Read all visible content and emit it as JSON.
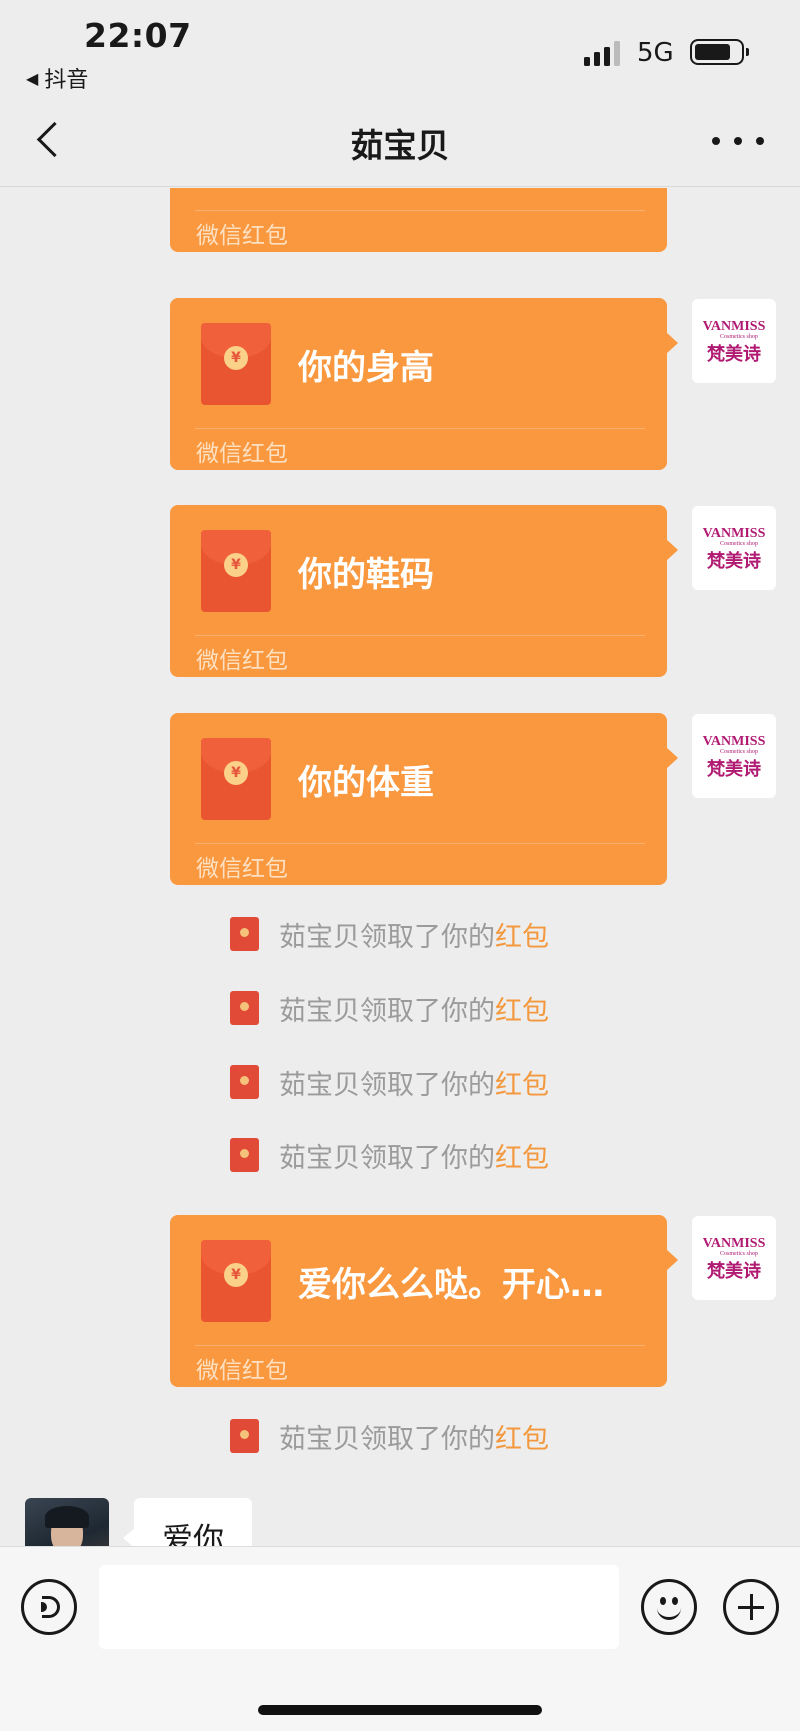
{
  "status_bar": {
    "time": "22:07",
    "back_app": "抖音",
    "network": "5G",
    "battery_level": 0.8
  },
  "header": {
    "title": "茹宝贝"
  },
  "messages": [
    {
      "type": "red_packet",
      "text": "",
      "footer": "微信红包"
    },
    {
      "type": "red_packet",
      "text": "你的身高",
      "footer": "微信红包",
      "avatar": {
        "brand": "VANMISS",
        "sub": "Cosmetics shop",
        "cn": "梵美诗"
      }
    },
    {
      "type": "red_packet",
      "text": "你的鞋码",
      "footer": "微信红包",
      "avatar": {
        "brand": "VANMISS",
        "sub": "Cosmetics shop",
        "cn": "梵美诗"
      }
    },
    {
      "type": "red_packet",
      "text": "你的体重",
      "footer": "微信红包",
      "avatar": {
        "brand": "VANMISS",
        "sub": "Cosmetics shop",
        "cn": "梵美诗"
      }
    },
    {
      "type": "notice",
      "text": "茹宝贝领取了你的",
      "highlight": "红包"
    },
    {
      "type": "notice",
      "text": "茹宝贝领取了你的",
      "highlight": "红包"
    },
    {
      "type": "notice",
      "text": "茹宝贝领取了你的",
      "highlight": "红包"
    },
    {
      "type": "notice",
      "text": "茹宝贝领取了你的",
      "highlight": "红包"
    },
    {
      "type": "red_packet",
      "text": "爱你么么哒。开心…",
      "footer": "微信红包",
      "avatar": {
        "brand": "VANMISS",
        "sub": "Cosmetics shop",
        "cn": "梵美诗"
      }
    },
    {
      "type": "notice",
      "text": "茹宝贝领取了你的",
      "highlight": "红包"
    },
    {
      "type": "text_in",
      "text": "爱你"
    }
  ],
  "icons": {
    "coin": "¥"
  },
  "colors": {
    "packet": "#f9983e",
    "envelope": "#ea5531",
    "highlight": "#f3983d"
  }
}
